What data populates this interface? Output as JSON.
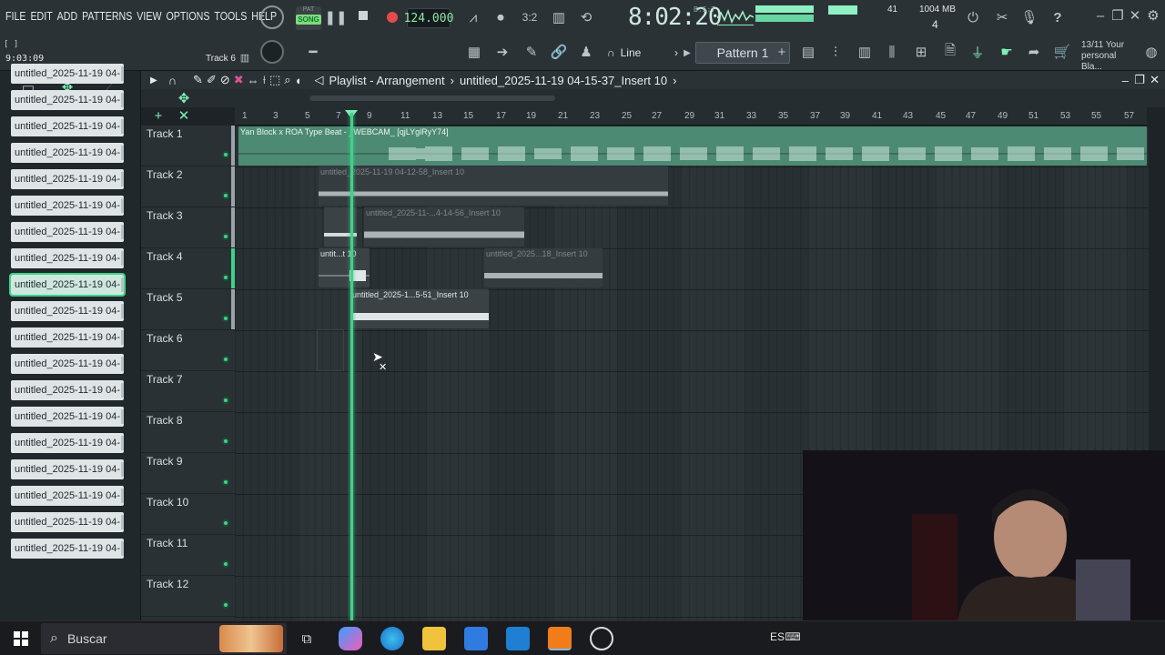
{
  "menu": [
    "FILE",
    "EDIT",
    "ADD",
    "PATTERNS",
    "VIEW",
    "OPTIONS",
    "TOOLS",
    "HELP"
  ],
  "transport": {
    "pat_label": "PAT",
    "song_label": "SONG",
    "tempo": "124.000"
  },
  "clock": {
    "time": "8:02:20",
    "unit": "B:S:T"
  },
  "monitor": {
    "cpu": "41",
    "mem": "1004 MB",
    "poly": "4"
  },
  "hint_panel": {
    "line1": "13/11 Your",
    "line2": "personal Bla..."
  },
  "top_left": {
    "bracket": "[ ]",
    "time": "9:03:09",
    "track": "Track 6"
  },
  "snap": {
    "label": "Line"
  },
  "pattern": {
    "label": "Pattern 1"
  },
  "playlist": {
    "title": "Playlist - Arrangement",
    "file": "untitled_2025-11-19 04-15-37_Insert 10"
  },
  "ruler": [
    "1",
    "3",
    "5",
    "7",
    "9",
    "11",
    "13",
    "15",
    "17",
    "19",
    "21",
    "23",
    "25",
    "27",
    "29",
    "31",
    "33",
    "35",
    "37",
    "39",
    "41",
    "43",
    "45",
    "47",
    "49",
    "51",
    "53",
    "55",
    "57"
  ],
  "tracks": [
    "Track 1",
    "Track 2",
    "Track 3",
    "Track 4",
    "Track 5",
    "Track 6",
    "Track 7",
    "Track 8",
    "Track 9",
    "Track 10",
    "Track 11",
    "Track 12"
  ],
  "browser_items": [
    "untitled_2025-11-19 04-...",
    "untitled_2025-11-19 04-...",
    "untitled_2025-11-19 04-...",
    "untitled_2025-11-19 04-...",
    "untitled_2025-11-19 04-...",
    "untitled_2025-11-19 04-...",
    "untitled_2025-11-19 04-...",
    "untitled_2025-11-19 04-...",
    "untitled_2025-11-19 04-...",
    "untitled_2025-11-19 04-...",
    "untitled_2025-11-19 04-...",
    "untitled_2025-11-19 04-...",
    "untitled_2025-11-19 04-...",
    "untitled_2025-11-19 04-...",
    "untitled_2025-11-19 04-...",
    "untitled_2025-11-19 04-...",
    "untitled_2025-11-19 04-...",
    "untitled_2025-11-19 04-...",
    "untitled_2025-11-19 04-..."
  ],
  "clips": {
    "t1": "Yan Block x ROA Type Beat - _WEBCAM_ [qjLYglRyY74]",
    "t2": "untitled_2025-11-19 04-12-58_Insert 10",
    "t3": "untitled_2025-11-...4-14-56_Insert 10",
    "t4a": "untit...t 10",
    "t4b": "untitled_2025...18_Insert 10",
    "t5": "untitled_2025-1...5-51_Insert 10"
  },
  "taskbar": {
    "search_placeholder": "Buscar",
    "lang": "ES"
  },
  "colors": {
    "accent": "#3fd28a",
    "track1_clip": "#4d8a73",
    "clip_dark": "#353c40"
  }
}
